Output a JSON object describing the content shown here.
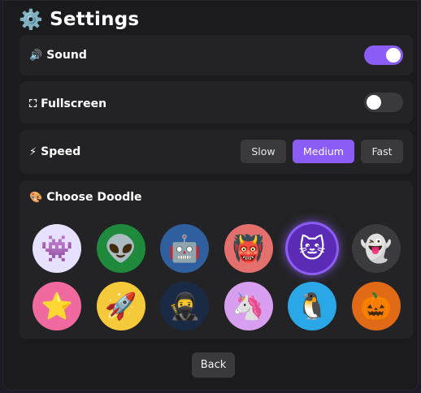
{
  "header": {
    "icon": "⚙️",
    "icon_name": "gear-icon",
    "title": "Settings"
  },
  "sound": {
    "icon": "🔊",
    "icon_name": "speaker-icon",
    "label": "Sound",
    "enabled": true
  },
  "fullscreen": {
    "icon": "⛶",
    "icon_name": "fullscreen-icon",
    "label": "Fullscreen",
    "enabled": false
  },
  "speed": {
    "icon": "⚡",
    "icon_name": "lightning-icon",
    "label": "Speed",
    "options": [
      "Slow",
      "Medium",
      "Fast"
    ],
    "selected": "Medium"
  },
  "doodle": {
    "icon": "🎨",
    "icon_name": "palette-icon",
    "label": "Choose Doodle",
    "selected_index": 4,
    "items": [
      {
        "emoji": "👾",
        "name": "alien-monster",
        "bg": "#e7e1ff"
      },
      {
        "emoji": "👽",
        "name": "alien",
        "bg": "#1f8a3c"
      },
      {
        "emoji": "🤖",
        "name": "robot",
        "bg": "#2f5f9e"
      },
      {
        "emoji": "👹",
        "name": "ogre",
        "bg": "#e4706e"
      },
      {
        "emoji": "🐱",
        "name": "cat",
        "bg": "#5b2bb5"
      },
      {
        "emoji": "👻",
        "name": "ghost",
        "bg": "#3b3b3d"
      },
      {
        "emoji": "⭐",
        "name": "star",
        "bg": "#f06aa0"
      },
      {
        "emoji": "🚀",
        "name": "rocket",
        "bg": "#f4c93a"
      },
      {
        "emoji": "🥷",
        "name": "ninja",
        "bg": "#1b2a44"
      },
      {
        "emoji": "🦄",
        "name": "unicorn",
        "bg": "#d89ef0"
      },
      {
        "emoji": "🐧",
        "name": "penguin",
        "bg": "#2aa7e6"
      },
      {
        "emoji": "🎃",
        "name": "pumpkin",
        "bg": "#e06a16"
      }
    ]
  },
  "back": {
    "label": "Back"
  },
  "colors": {
    "accent": "#8b5cf6",
    "card": "#232325",
    "toggle_off": "#3a3a3d",
    "button": "#3a3a3d"
  }
}
